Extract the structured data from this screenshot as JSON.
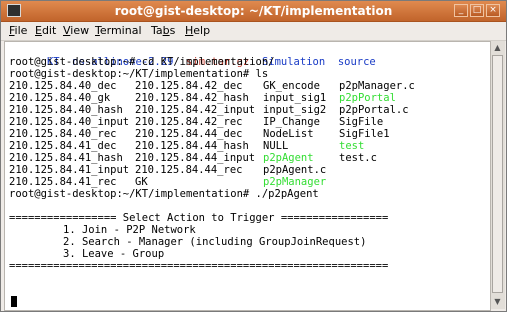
{
  "window": {
    "title": "root@gist-desktop: ~/KT/implementation",
    "controls": {
      "minimize": "_",
      "maximize": "□",
      "close": "×"
    }
  },
  "menubar": {
    "items": [
      "File",
      "Edit",
      "View",
      "Terminal",
      "Tabs",
      "Help"
    ],
    "underline": [
      "F",
      "E",
      "V",
      "T",
      "b",
      "H"
    ]
  },
  "terminal": {
    "line1": {
      "kt": "KT",
      "ns": "ns-allinone-2.29",
      "sim": "sim.tar.gz",
      "simulation": "Simulation",
      "source": "source"
    },
    "prompt_cd": "root@gist-desktop:~# cd KT/implementation/",
    "prompt_ls": "root@gist-desktop:~/KT/implementation# ls",
    "ls_rows": [
      [
        "210.125.84.40_dec",
        "210.125.84.42_dec",
        "GK_encode",
        "p2pManager.c"
      ],
      [
        "210.125.84.40_gk",
        "210.125.84.42_hash",
        "input_sig1",
        "p2pPortal"
      ],
      [
        "210.125.84.40_hash",
        "210.125.84.42_input",
        "input_sig2",
        "p2pPortal.c"
      ],
      [
        "210.125.84.40_input",
        "210.125.84.42_rec",
        "IP_Change",
        "SigFile"
      ],
      [
        "210.125.84.40_rec",
        "210.125.84.44_dec",
        "NodeList",
        "SigFile1"
      ],
      [
        "210.125.84.41_dec",
        "210.125.84.44_hash",
        "NULL",
        "test"
      ],
      [
        "210.125.84.41_hash",
        "210.125.84.44_input",
        "p2pAgent",
        "test.c"
      ],
      [
        "210.125.84.41_input",
        "210.125.84.44_rec",
        "p2pAgent.c",
        ""
      ],
      [
        "210.125.84.41_rec",
        "GK",
        "p2pManager",
        ""
      ]
    ],
    "green_entries": [
      "p2pPortal",
      "test",
      "p2pAgent",
      "p2pManager"
    ],
    "prompt_run": "root@gist-desktop:~/KT/implementation# ./p2pAgent",
    "menu_header": "================= Select Action to Trigger =================",
    "menu_options": [
      "1. Join - P2P Network",
      "2. Search - Manager (including GroupJoinRequest)",
      "3. Leave - Group"
    ],
    "menu_footer": "============================================================"
  },
  "colors": {
    "titlebar": "#c8692f",
    "green": "#33dd33",
    "blue": "#1a3cc6",
    "red": "#c0392b"
  }
}
